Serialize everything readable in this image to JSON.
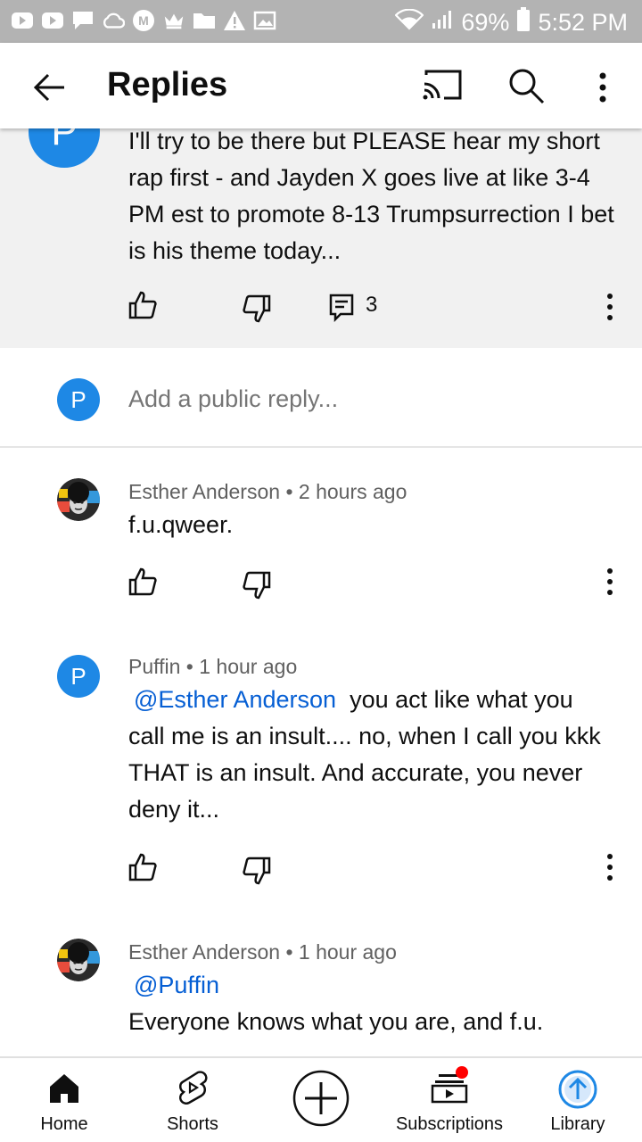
{
  "status_bar": {
    "battery": "69%",
    "time": "5:52 PM"
  },
  "app_bar": {
    "title": "Replies"
  },
  "parent_comment": {
    "avatar_letter": "P",
    "text": "I'll try to be there but PLEASE hear my short rap first - and Jayden X goes live at like 3-4 PM est to promote 8-13 Trumpsurrection I bet is his theme today...",
    "reply_count": "3"
  },
  "add_reply": {
    "avatar_letter": "P",
    "placeholder": "Add a public reply..."
  },
  "replies": [
    {
      "author": "Esther Anderson",
      "separator": "•",
      "time": "2 hours ago",
      "mention": "",
      "text": "f.u.qweer."
    },
    {
      "avatar_letter": "P",
      "author": "Puffin",
      "separator": "•",
      "time": "1 hour ago",
      "mention": "@Esther Anderson",
      "text": "you act like what you call me is an insult.... no, when I call you kkk THAT is an insult. And accurate, you never deny it..."
    },
    {
      "author": "Esther Anderson",
      "separator": "•",
      "time": "1 hour ago",
      "mention": "@Puffin",
      "text": "Everyone knows what you are, and f.u."
    }
  ],
  "bottom_nav": {
    "home": "Home",
    "shorts": "Shorts",
    "subscriptions": "Subscriptions",
    "library": "Library"
  },
  "colors": {
    "accent": "#1e88e5",
    "mention": "#065fd4",
    "notification_dot": "#ff0000"
  }
}
